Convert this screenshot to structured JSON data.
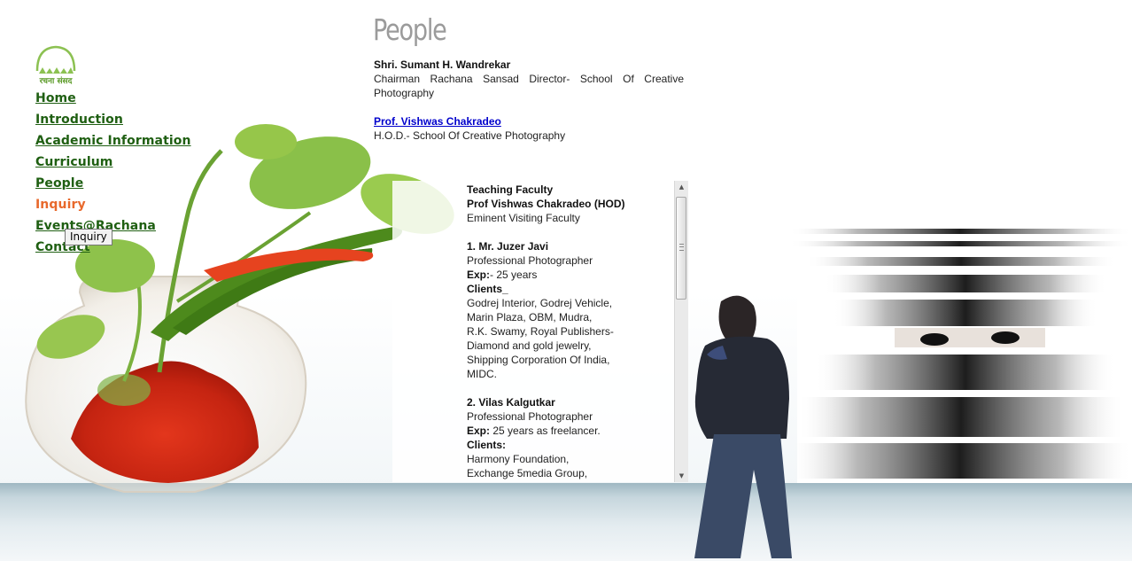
{
  "logo": {
    "text": "रचना संसद"
  },
  "nav": {
    "items": [
      {
        "label": "Home"
      },
      {
        "label": "Introduction"
      },
      {
        "label": "Academic Information"
      },
      {
        "label": "Curriculum"
      },
      {
        "label": "People"
      },
      {
        "label": "Inquiry"
      },
      {
        "label": "Events@Rachana"
      },
      {
        "label": "Contact"
      }
    ],
    "active": "Inquiry"
  },
  "tooltip": {
    "text": "Inquiry"
  },
  "page_title": "People",
  "intro": {
    "person1_name": "Shri. Sumant H. Wandrekar",
    "person1_desc": "Chairman Rachana Sansad Director- School Of Creative Photography",
    "person2_name": "Prof. Vishwas Chakradeo",
    "person2_desc": "H.O.D.- School Of Creative Photography"
  },
  "faculty": {
    "heading": "Teaching Faculty",
    "hod": "Prof Vishwas Chakradeo (HOD)",
    "visiting": "Eminent Visiting Faculty",
    "members": [
      {
        "name": "1. Mr. Juzer Javi",
        "role": "Professional Photographer",
        "exp_label": "Exp:",
        "exp_value": "- 25 years",
        "clients_label": "Clients_",
        "clients_lines": [
          "Godrej Interior, Godrej Vehicle,",
          "Marin Plaza, OBM, Mudra,",
          "R.K. Swamy, Royal Publishers-",
          "Diamond and gold jewelry,",
          "Shipping Corporation Of India,",
          "MIDC."
        ]
      },
      {
        "name": "2. Vilas Kalgutkar",
        "role": "Professional Photographer",
        "exp_label": "Exp:",
        "exp_value": " 25 years as freelancer.",
        "clients_label": "Clients:",
        "clients_lines": [
          "Harmony Foundation,",
          "Exchange 5media Group,"
        ]
      }
    ]
  },
  "colors": {
    "nav_link": "#1f5f12",
    "nav_active": "#e8692c",
    "title": "#9b9b9b",
    "link": "#0000cc"
  }
}
